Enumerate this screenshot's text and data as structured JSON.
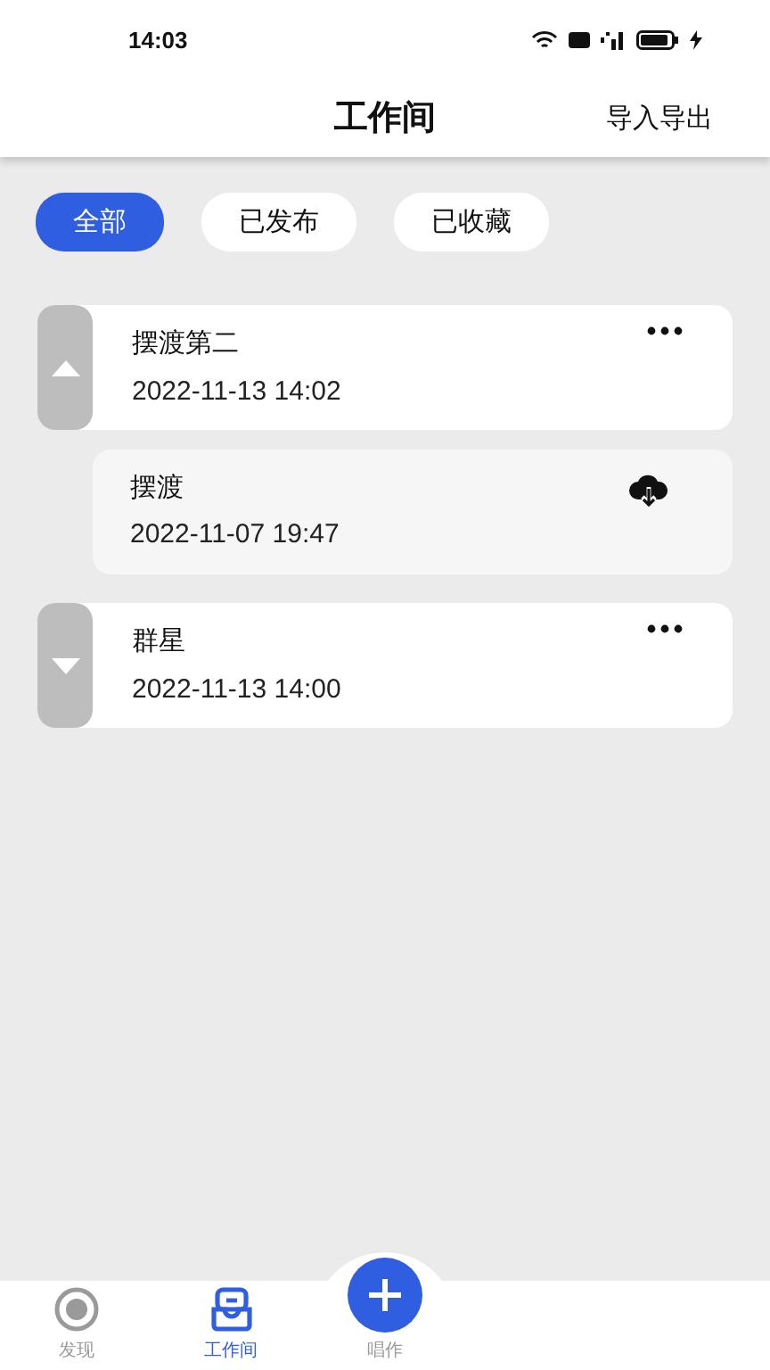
{
  "status_bar": {
    "time": "14:03"
  },
  "header": {
    "title": "工作间",
    "action": "导入导出"
  },
  "filters": [
    {
      "label": "全部",
      "selected": true
    },
    {
      "label": "已发布",
      "selected": false
    },
    {
      "label": "已收藏",
      "selected": false
    }
  ],
  "groups": [
    {
      "title": "摆渡第二",
      "date": "2022-11-13 14:02",
      "expanded": true,
      "children": [
        {
          "title": "摆渡",
          "date": "2022-11-07 19:47"
        }
      ]
    },
    {
      "title": "群星",
      "date": "2022-11-13 14:00",
      "expanded": false
    }
  ],
  "nav": [
    {
      "label": "发现",
      "kind": "discover",
      "selected": false
    },
    {
      "label": "工作间",
      "kind": "workspace",
      "selected": true
    },
    {
      "label": "唱作",
      "kind": "create",
      "selected": false
    }
  ]
}
